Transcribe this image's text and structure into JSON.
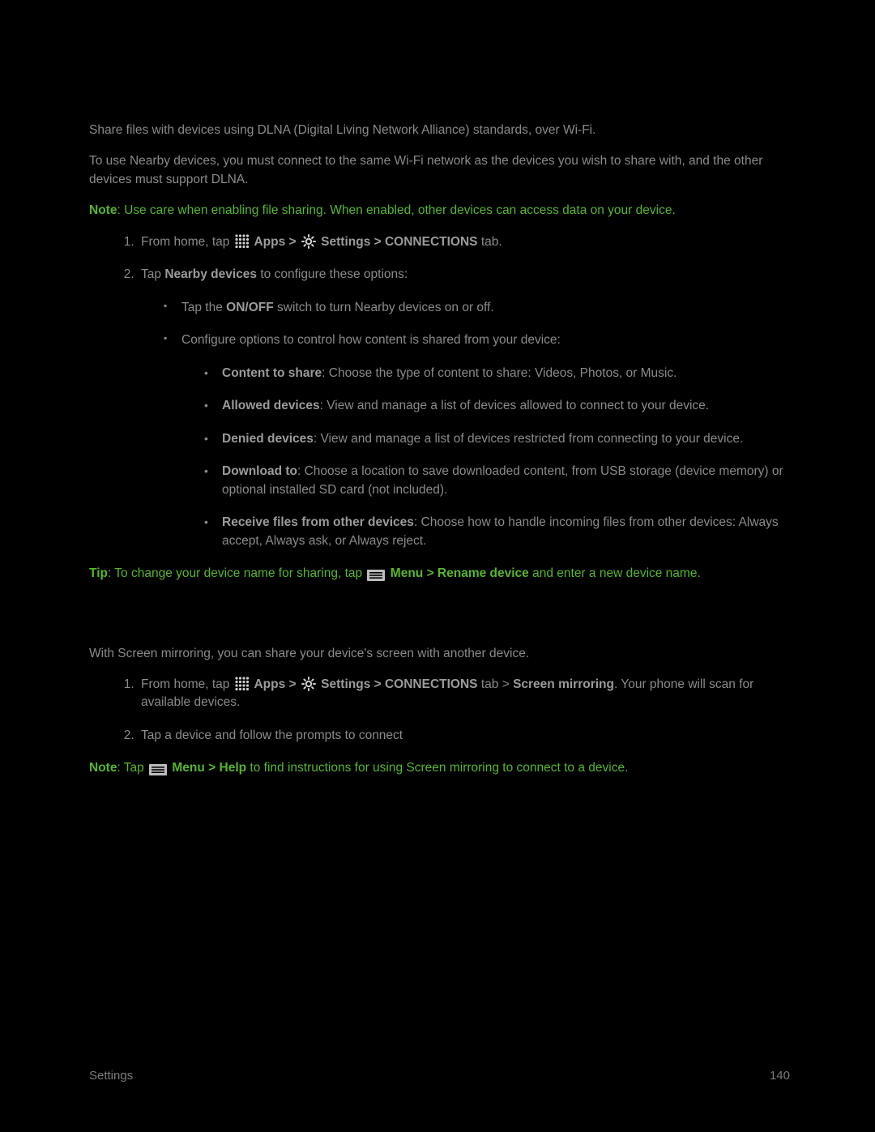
{
  "section1": {
    "intro1": "Share files with devices using DLNA (Digital Living Network Alliance) standards, over Wi-Fi.",
    "intro2": "To use Nearby devices, you must connect to the same Wi-Fi network as the devices you wish to share with, and the other devices must support DLNA.",
    "note_label": "Note",
    "note_text": ": Use care when enabling file sharing. When enabled, other devices can access data on your device.",
    "step1_prefix": "From home, tap ",
    "apps_label": " Apps > ",
    "settings_label": " Settings > CONNECTIONS",
    "step1_suffix": " tab.",
    "step2_prefix": "Tap ",
    "step2_bold": "Nearby devices",
    "step2_suffix": " to configure these options:",
    "sub1_prefix": "Tap the ",
    "sub1_bold": "ON/OFF",
    "sub1_suffix": " switch to turn Nearby devices on or off.",
    "sub2": "Configure options to control how content is shared from your device:",
    "opt1_bold": "Content to share",
    "opt1_text": ": Choose the type of content to share: Videos, Photos, or Music.",
    "opt2_bold": "Allowed devices",
    "opt2_text": ": View and manage a list of devices allowed to connect to your device.",
    "opt3_bold": "Denied devices",
    "opt3_text": ": View and manage a list of devices restricted from connecting to your device.",
    "opt4_bold": "Download to",
    "opt4_text": ": Choose a location to save downloaded content, from USB storage (device memory) or optional installed SD card (not included).",
    "opt5_bold": "Receive files from other devices",
    "opt5_text": ": Choose how to handle incoming files from other devices: Always accept, Always ask, or Always reject.",
    "tip_label": "Tip",
    "tip_prefix": ": To change your device name for sharing, tap ",
    "tip_bold": " Menu > Rename device",
    "tip_suffix": " and enter a new device name."
  },
  "section2": {
    "intro": "With Screen mirroring, you can share your device's screen with another device.",
    "step1_prefix": "From home, tap ",
    "apps_label": " Apps > ",
    "settings_label": " Settings > CONNECTIONS",
    "step1_mid": " tab > ",
    "step1_bold2": "Screen mirroring",
    "step1_suffix": ". Your phone will scan for available devices.",
    "step2": "Tap a device and follow the prompts to connect",
    "note_label": "Note",
    "note_prefix": ": Tap ",
    "note_bold": " Menu > Help",
    "note_suffix": " to find instructions for using Screen mirroring to connect to a device."
  },
  "footer": {
    "left": "Settings",
    "right": "140"
  }
}
